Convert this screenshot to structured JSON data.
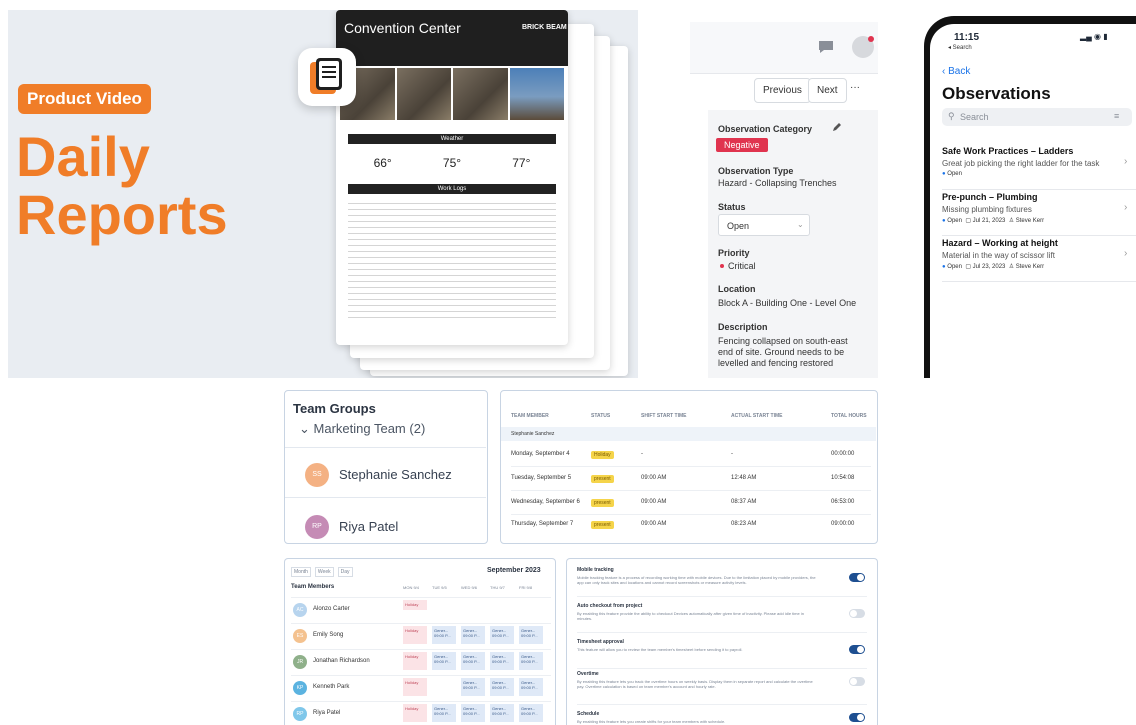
{
  "promo": {
    "tag": "Product Video",
    "title_line1": "Daily",
    "title_line2": "Reports",
    "report": {
      "title": "Convention Center",
      "logo": "BRICK BEAM",
      "weather_header": "Weather",
      "temps": [
        "66°",
        "75°",
        "77°"
      ],
      "work_logs_header": "Work Logs"
    }
  },
  "observation": {
    "previous": "Previous",
    "next": "Next",
    "more": "···",
    "category_label": "Observation Category",
    "category_value": "Negative",
    "type_label": "Observation Type",
    "type_value": "Hazard - Collapsing Trenches",
    "status_label": "Status",
    "status_value": "Open",
    "priority_label": "Priority",
    "priority_value": "Critical",
    "location_label": "Location",
    "location_value": "Block A - Building One - Level One",
    "description_label": "Description",
    "description_value": "Fencing collapsed on south-east end of site. Ground needs to be levelled and fencing restored"
  },
  "phone": {
    "time": "11:15",
    "back_app": "◂ Search",
    "back": "Back",
    "title": "Observations",
    "search_placeholder": "Search",
    "items": [
      {
        "title": "Safe Work Practices – Ladders",
        "desc": "Great job picking the right ladder for the task",
        "status": "Open",
        "date": "",
        "person": ""
      },
      {
        "title": "Pre-punch – Plumbing",
        "desc": "Missing plumbing fixtures",
        "status": "Open",
        "date": "Jul 21, 2023",
        "person": "Steve Kerr"
      },
      {
        "title": "Hazard – Working at height",
        "desc": "Material in the way of scissor lift",
        "status": "Open",
        "date": "Jul 23, 2023",
        "person": "Steve Kerr"
      }
    ]
  },
  "team_groups": {
    "title": "Team Groups",
    "group": "Marketing Team",
    "count": "(2)",
    "members": [
      {
        "initials": "SS",
        "name": "Stephanie Sanchez",
        "color": "#f4b183"
      },
      {
        "initials": "RP",
        "name": "Riya Patel",
        "color": "#c58bb5"
      }
    ]
  },
  "attendance": {
    "headers": [
      "TEAM MEMBER",
      "STATUS",
      "SHIFT START TIME",
      "ACTUAL START TIME",
      "TOTAL HOURS"
    ],
    "group_row": "Stephanie Sanchez",
    "rows": [
      {
        "day": "Monday, September 4",
        "status": "Holiday",
        "shift": "-",
        "actual": "-",
        "hours": "00:00:00"
      },
      {
        "day": "Tuesday, September 5",
        "status": "present",
        "shift": "09:00 AM",
        "actual": "12:48 AM",
        "hours": "10:54:08"
      },
      {
        "day": "Wednesday, September 6",
        "status": "present",
        "shift": "09:00 AM",
        "actual": "08:37 AM",
        "hours": "06:53:00"
      },
      {
        "day": "Thursday, September 7",
        "status": "present",
        "shift": "09:00 AM",
        "actual": "08:23 AM",
        "hours": "09:00:00"
      }
    ]
  },
  "schedule": {
    "views": [
      "Month",
      "Week",
      "Day"
    ],
    "month": "September 2023",
    "col_header": "Team Members",
    "days": [
      "MON 9/4",
      "TUE 9/5",
      "WED 9/6",
      "THU 9/7",
      "FRI 9/8"
    ],
    "members": [
      {
        "initials": "AC",
        "name": "Alonzo Carter",
        "color": "#b7d4ee"
      },
      {
        "initials": "ES",
        "name": "Emily Song",
        "color": "#f4c28f"
      },
      {
        "initials": "JR",
        "name": "Jonathan Richardson",
        "color": "#8fb08a"
      },
      {
        "initials": "KP",
        "name": "Kenneth Park",
        "color": "#5bb3e0"
      },
      {
        "initials": "RP",
        "name": "Riya Patel",
        "color": "#7fc7ea"
      }
    ],
    "holiday": "Holiday",
    "shift_label": "Gener...",
    "shift_time": "09:00 P..."
  },
  "settings": {
    "items": [
      {
        "title": "Mobile tracking",
        "desc": "Mobile tracking feature is a process of recording working time with mobile devices. Due to the limitation placed by mobile providers, the app can only track sites and locations and cannot record screenshots or measure activity levels.",
        "on": true
      },
      {
        "title": "Auto checkout from project",
        "desc": "By enabling this feature provide the ability to checkout Devices automatically after given time of inactivity. Please add idle time in minutes.",
        "on": false
      },
      {
        "title": "Timesheet approval",
        "desc": "This feature will allow you to review the team member's timesheet before sending it to payroll.",
        "on": true
      },
      {
        "title": "Overtime",
        "desc": "By enabling this feature lets you track the overtime hours on weekly basis. Display them in separate report and calculate the overtime pay. Overtime calculation is based on team member's account and hourly rate.",
        "on": false
      },
      {
        "title": "Schedule",
        "desc": "By enabling this feature lets you create shifts for your team members with schedule.",
        "on": true
      }
    ]
  }
}
